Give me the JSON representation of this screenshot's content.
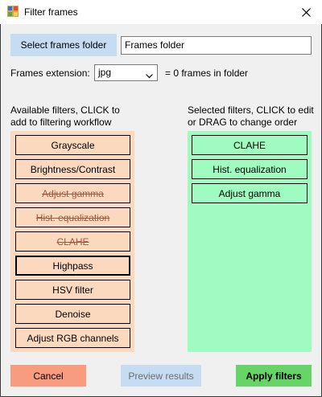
{
  "window": {
    "title": "Filter frames"
  },
  "folder": {
    "button_label": "Select frames folder",
    "value": "Frames folder"
  },
  "extension": {
    "label": "Frames extension:",
    "selected": "jpg",
    "info": "= 0 frames in folder"
  },
  "available": {
    "header_line1": "Available filters, CLICK to",
    "header_line2": "add to filtering workflow",
    "items": [
      {
        "label": "Grayscale",
        "state": "normal"
      },
      {
        "label": "Brightness/Contrast",
        "state": "normal"
      },
      {
        "label": "Adjust gamma",
        "state": "used"
      },
      {
        "label": "Hist. equalization",
        "state": "used"
      },
      {
        "label": "CLAHE",
        "state": "used"
      },
      {
        "label": "Highpass",
        "state": "focused"
      },
      {
        "label": "HSV filter",
        "state": "normal"
      },
      {
        "label": "Denoise",
        "state": "normal"
      },
      {
        "label": "Adjust RGB channels",
        "state": "normal"
      }
    ]
  },
  "selected": {
    "header_line1": "Selected filters, CLICK to edit",
    "header_line2": "or DRAG to change order",
    "items": [
      {
        "label": "CLAHE"
      },
      {
        "label": "Hist. equalization"
      },
      {
        "label": "Adjust gamma"
      }
    ]
  },
  "actions": {
    "cancel": "Cancel",
    "preview": "Preview results",
    "apply": "Apply filters"
  },
  "colors": {
    "available_bg": "#fbd9bf",
    "selected_bg": "#9ffbbf",
    "cancel": "#f89b7f",
    "apply": "#66d466",
    "folder_button": "#c5dcf3"
  },
  "icons": {
    "app": "app-icon",
    "close": "close-icon",
    "dropdown": "chevron-down-icon"
  }
}
